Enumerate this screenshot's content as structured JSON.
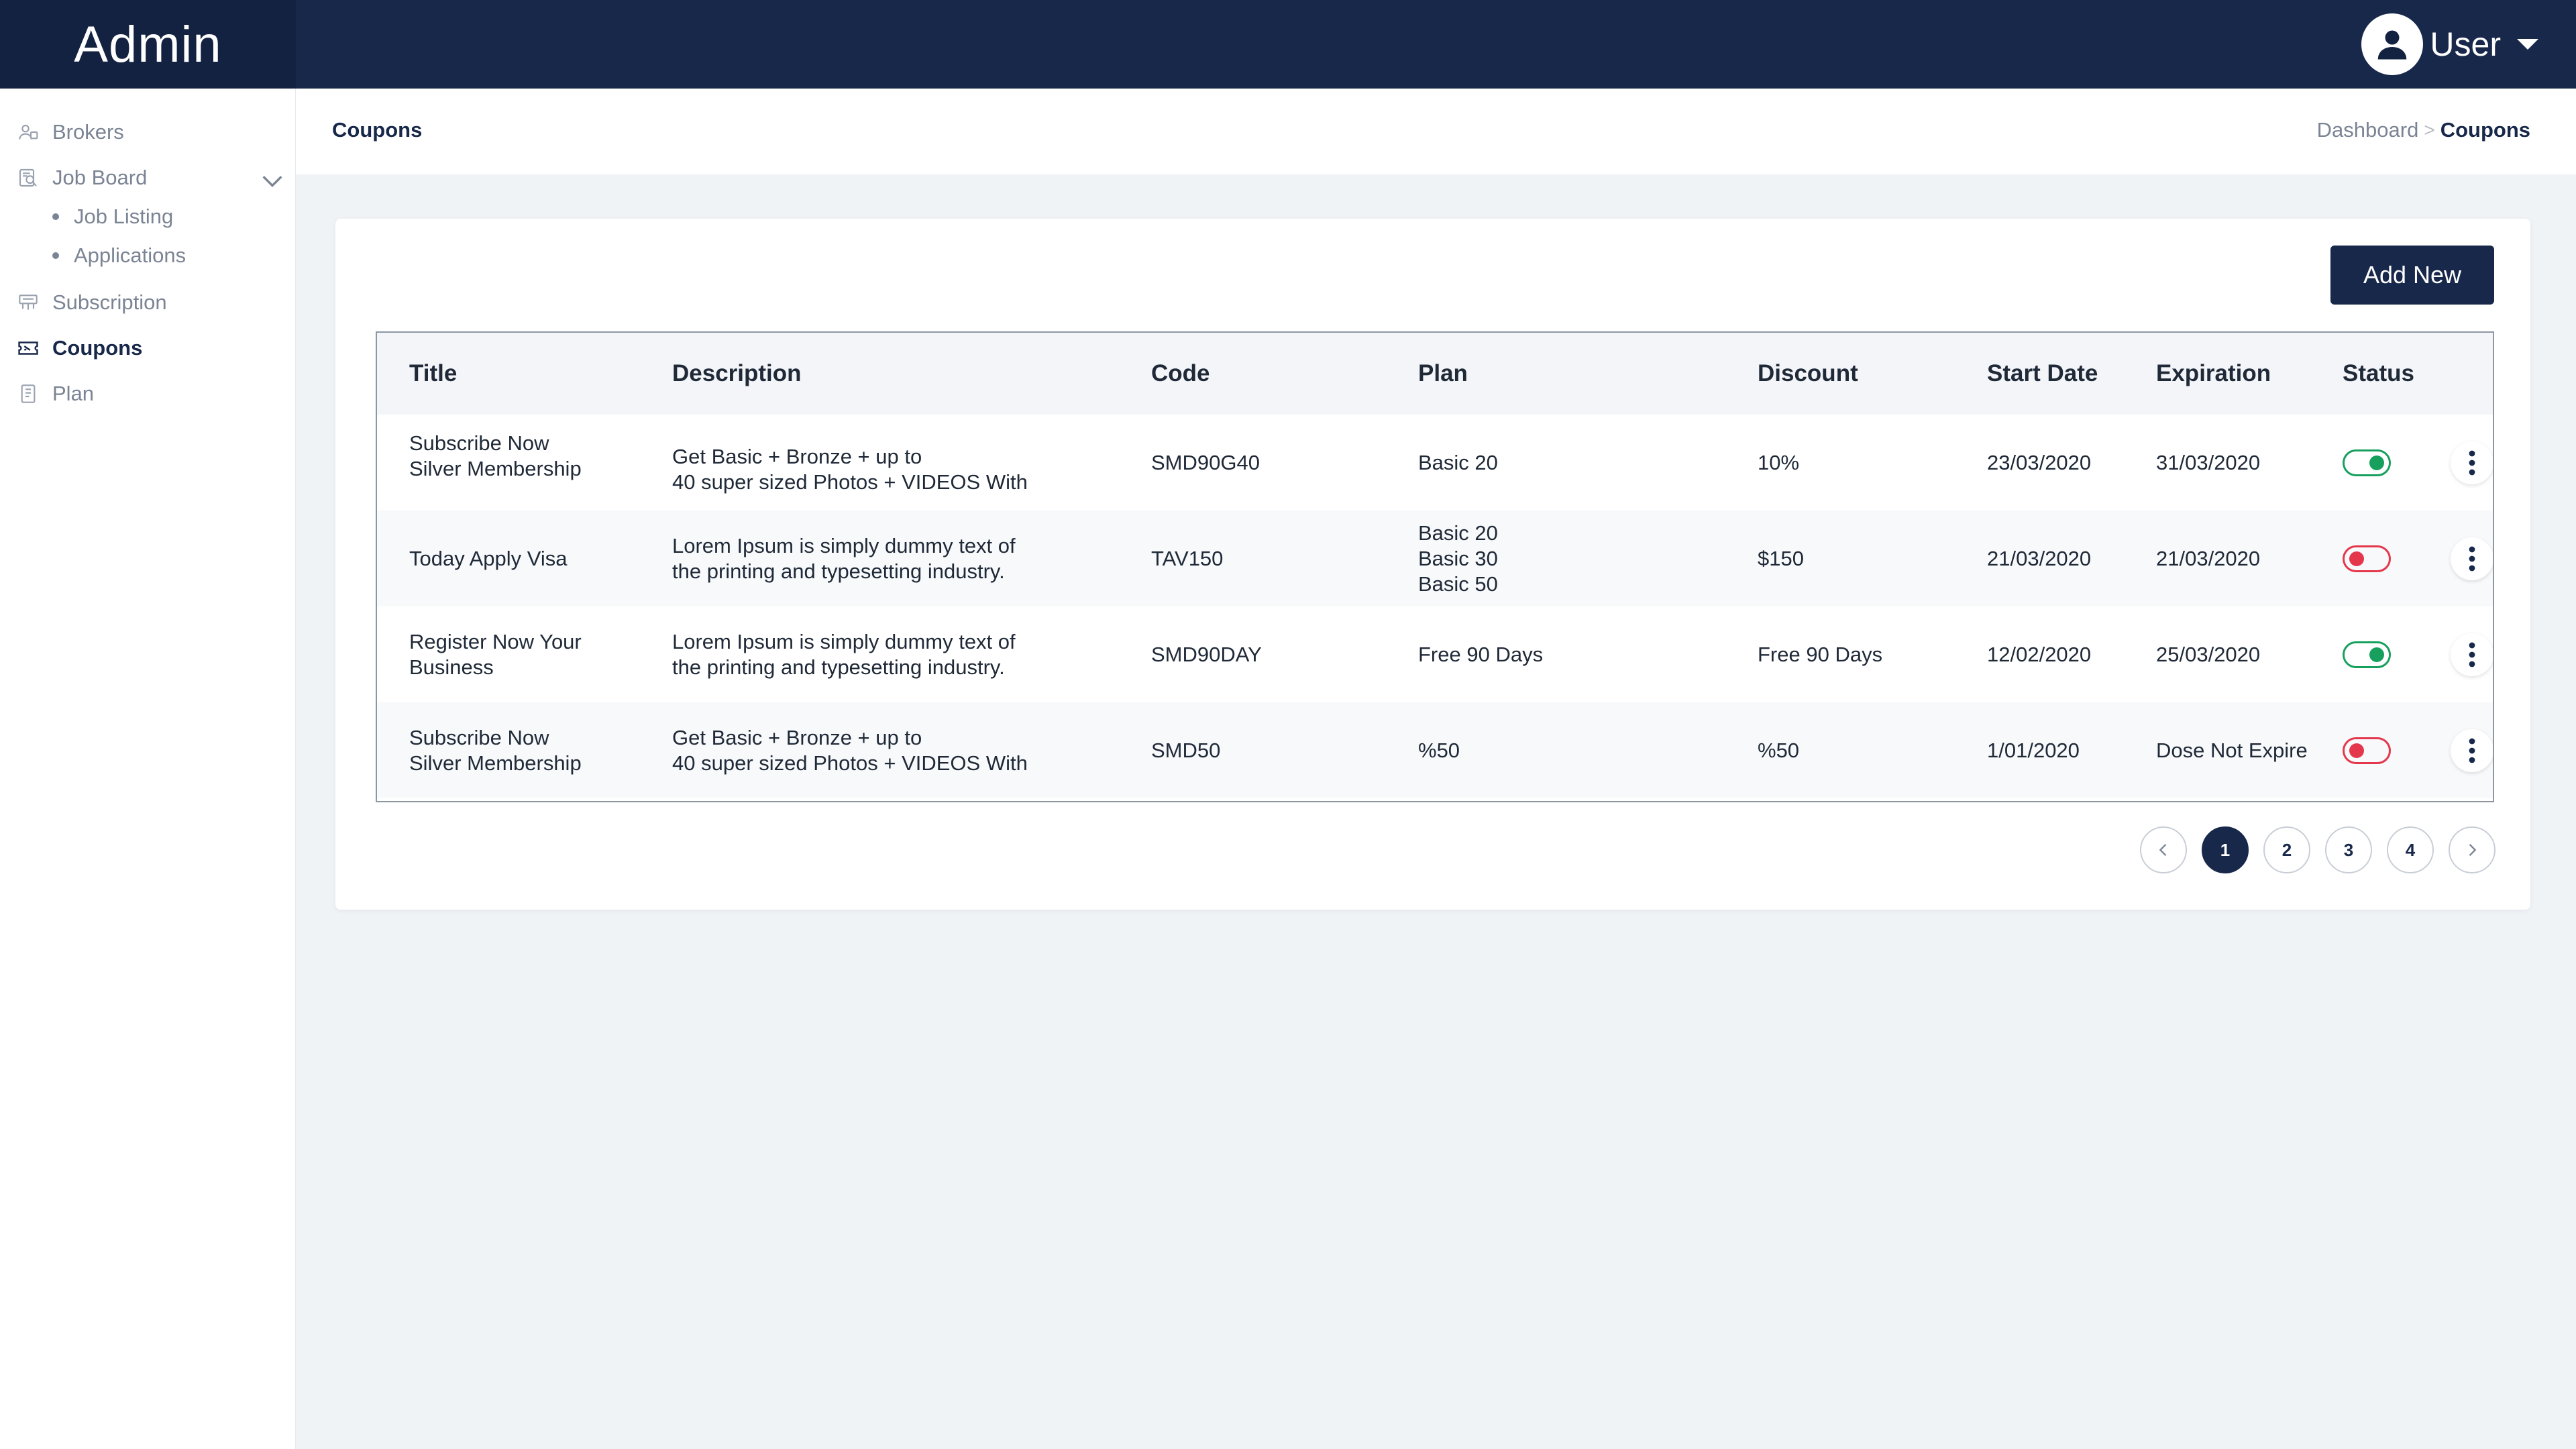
{
  "app": {
    "brand": "Admin"
  },
  "user": {
    "label": "User"
  },
  "sidebar": {
    "items": [
      {
        "label": "Brokers",
        "icon": "brokers-icon"
      },
      {
        "label": "Job Board",
        "icon": "job-board-icon",
        "children": [
          "Job Listing",
          "Applications"
        ]
      },
      {
        "label": "Subscription",
        "icon": "subscription-icon"
      },
      {
        "label": "Coupons",
        "icon": "coupon-icon",
        "active": true
      },
      {
        "label": "Plan",
        "icon": "plan-icon"
      }
    ]
  },
  "header": {
    "title": "Coupons",
    "breadcrumb": {
      "home": "Dashboard",
      "separator": ">",
      "current": "Coupons"
    }
  },
  "toolbar": {
    "add_label": "Add New"
  },
  "table": {
    "columns": [
      "Title",
      "Description",
      "Code",
      "Plan",
      "Discount",
      "Start Date",
      "Expiration",
      "Status"
    ],
    "rows": [
      {
        "title": [
          "Subscribe Now",
          "Silver Membership"
        ],
        "description": [
          "Get Basic + Bronze + up to",
          "40 super sized Photos + VIDEOS With"
        ],
        "code": "SMD90G40",
        "plan": [
          "Basic 20"
        ],
        "discount": "10%",
        "start": "23/03/2020",
        "expiration": "31/03/2020",
        "status": "on"
      },
      {
        "title": [
          "Today Apply Visa"
        ],
        "description": [
          "Lorem Ipsum is simply dummy text of",
          "the printing and typesetting industry."
        ],
        "code": "TAV150",
        "plan": [
          "Basic 20",
          "Basic 30",
          "Basic 50"
        ],
        "discount": "$150",
        "start": "21/03/2020",
        "expiration": "21/03/2020",
        "status": "off"
      },
      {
        "title": [
          "Register Now Your",
          "Business"
        ],
        "description": [
          "Lorem Ipsum is simply dummy text of",
          "the printing and typesetting industry."
        ],
        "code": "SMD90DAY",
        "plan": [
          "Free 90 Days"
        ],
        "discount": "Free 90 Days",
        "start": "12/02/2020",
        "expiration": "25/03/2020",
        "status": "on"
      },
      {
        "title": [
          "Subscribe Now",
          "Silver Membership"
        ],
        "description": [
          "Get Basic + Bronze + up to",
          "40 super sized Photos + VIDEOS With"
        ],
        "code": "SMD50",
        "plan": [
          "%50"
        ],
        "discount": "%50",
        "start": "1/01/2020",
        "expiration": "Dose Not Expire",
        "status": "off"
      }
    ]
  },
  "pagination": {
    "pages": [
      "1",
      "2",
      "3",
      "4"
    ],
    "current": "1"
  },
  "colors": {
    "navy": "#18284a",
    "toggle_on": "#17a05d",
    "toggle_off": "#e5374c"
  }
}
